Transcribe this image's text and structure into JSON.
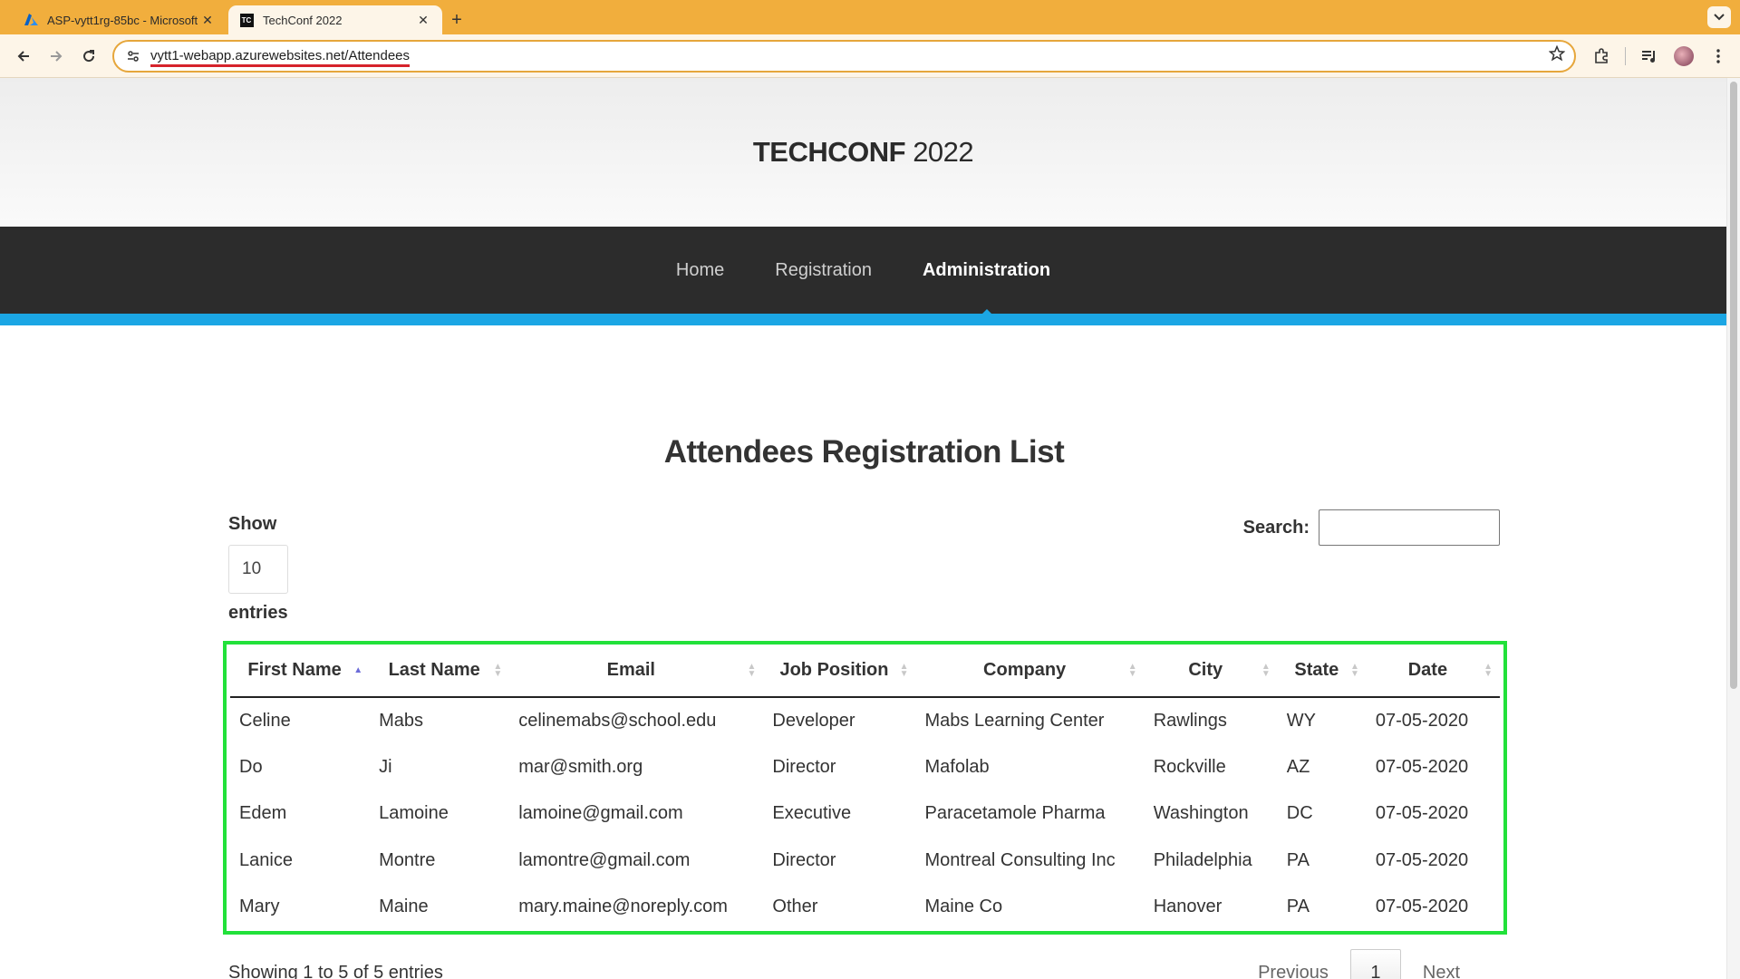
{
  "browser": {
    "tabs": [
      {
        "title": "ASP-vytt1rg-85bc - Microsoft",
        "active": false,
        "icon": "azure-icon"
      },
      {
        "title": "TechConf 2022",
        "active": true,
        "icon": "tc-icon",
        "icon_text": "TC"
      }
    ],
    "url": "vytt1-webapp.azurewebsites.net/Attendees"
  },
  "site": {
    "brand_bold": "TECHCONF",
    "brand_year": "2022",
    "nav": [
      {
        "label": "Home",
        "active": false
      },
      {
        "label": "Registration",
        "active": false
      },
      {
        "label": "Administration",
        "active": true
      }
    ],
    "accent_color": "#1ba6e4"
  },
  "main": {
    "title": "Attendees Registration List",
    "show_label": "Show",
    "page_length": "10",
    "entries_label": "entries",
    "search_label": "Search:",
    "search_value": "",
    "columns": [
      "First Name",
      "Last Name",
      "Email",
      "Job Position",
      "Company",
      "City",
      "State",
      "Date"
    ],
    "sorted_column": "First Name",
    "rows": [
      [
        "Celine",
        "Mabs",
        "celinemabs@school.edu",
        "Developer",
        "Mabs Learning Center",
        "Rawlings",
        "WY",
        "07-05-2020"
      ],
      [
        "Do",
        "Ji",
        "mar@smith.org",
        "Director",
        "Mafolab",
        "Rockville",
        "AZ",
        "07-05-2020"
      ],
      [
        "Edem",
        "Lamoine",
        "lamoine@gmail.com",
        "Executive",
        "Paracetamole Pharma",
        "Washington",
        "DC",
        "07-05-2020"
      ],
      [
        "Lanice",
        "Montre",
        "lamontre@gmail.com",
        "Director",
        "Montreal Consulting Inc",
        "Philadelphia",
        "PA",
        "07-05-2020"
      ],
      [
        "Mary",
        "Maine",
        "mary.maine@noreply.com",
        "Other",
        "Maine Co",
        "Hanover",
        "PA",
        "07-05-2020"
      ]
    ],
    "info": "Showing 1 to 5 of 5 entries",
    "pager": {
      "previous": "Previous",
      "current": "1",
      "next": "Next"
    },
    "highlight_color": "#22e13a"
  }
}
